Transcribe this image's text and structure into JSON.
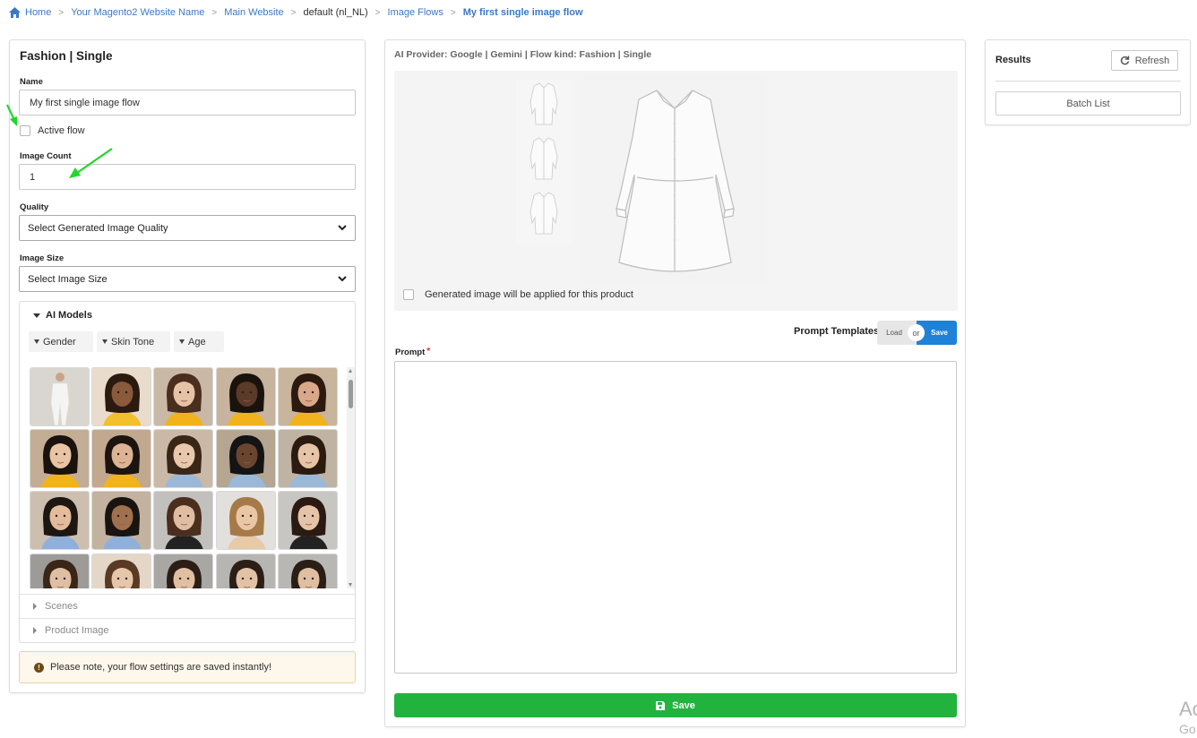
{
  "breadcrumb": {
    "items": [
      "Home",
      "Your Magento2 Website Name",
      "Main Website",
      "default (nl_NL)",
      "Image Flows",
      "My first single image flow"
    ]
  },
  "left": {
    "title": "Fashion | Single",
    "name_label": "Name",
    "name_value": "My first single image flow",
    "active_label": "Active flow",
    "active_checked": false,
    "count_label": "Image Count",
    "count_value": "1",
    "quality_label": "Quality",
    "quality_value": "Select Generated Image Quality",
    "size_label": "Image Size",
    "size_value": "Select Image Size",
    "models": {
      "heading": "AI Models",
      "filters": [
        "Gender",
        "Skin Tone",
        "Age"
      ],
      "rows": 4,
      "cols": 5
    },
    "scenes_label": "Scenes",
    "product_image_label": "Product Image",
    "notice": "Please note, your flow settings are saved instantly!"
  },
  "middle": {
    "provider": "AI Provider: Google | Gemini | Flow kind: Fashion | Single",
    "apply_label": "Generated image will be applied for this product",
    "prompt_templates_label": "Prompt Templates",
    "load_label": "Load",
    "or_label": "or",
    "save_template_label": "Save",
    "prompt_label": "Prompt",
    "prompt_required": "*",
    "prompt_value": "",
    "save_button_label": "Save"
  },
  "right": {
    "title": "Results",
    "refresh_label": "Refresh",
    "batch_label": "Batch List"
  },
  "watermark": {
    "line1": "Ac",
    "line2": "Go"
  },
  "colors": {
    "link": "#3b78c4",
    "save_green": "#22b33e",
    "template_blue": "#1f82d6",
    "annotation_arrow": "#22d62a"
  },
  "icons": [
    "home-icon",
    "chevron-down-icon",
    "caret-down-icon",
    "caret-right-icon",
    "info-icon",
    "refresh-icon",
    "floppy-disk-icon"
  ]
}
